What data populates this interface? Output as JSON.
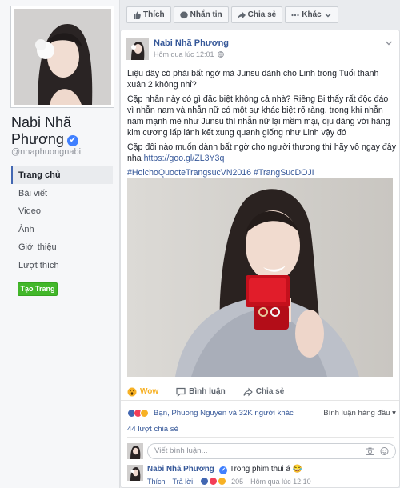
{
  "profile": {
    "name": "Nabi Nhã Phương",
    "handle": "@nhaphuongnabi",
    "verified_mark": "✔"
  },
  "nav": {
    "items": [
      {
        "label": "Trang chủ",
        "active": true
      },
      {
        "label": "Bài viết",
        "active": false
      },
      {
        "label": "Video",
        "active": false
      },
      {
        "label": "Ảnh",
        "active": false
      },
      {
        "label": "Giới thiệu",
        "active": false
      },
      {
        "label": "Lượt thích",
        "active": false
      }
    ],
    "create_page": "Tạo Trang"
  },
  "top_actions": {
    "like": "Thích",
    "message": "Nhắn tin",
    "share": "Chia sẻ",
    "more": "Khác"
  },
  "post": {
    "author": "Nabi Nhã Phương",
    "time": "Hôm qua lúc 12:01",
    "p1": "Liệu đây có phải bất ngờ mà Junsu dành cho Linh trong Tuổi thanh xuân 2 không nhỉ?",
    "p2": "Cặp nhẫn này có gì đặc biệt không cả nhà? Riêng Bi thấy rất độc đáo vì nhẫn nam và nhẫn nữ có một sự khác biệt rõ ràng, trong khi nhẫn nam mạnh mẽ như Junsu thì nhẫn nữ lại mềm mại, dịu dàng với hàng kim cương lấp lánh kết xung quanh giống như Linh vậy đó",
    "p3_text": "Cặp đôi nào muốn dành bất ngờ cho người thương thì hãy vô ngay đây nha ",
    "p3_link": "https://goo.gl/ZL3Y3q",
    "hashtags": "#HoichoQuocteTrangsucVN2016 #TrangSucDOJI"
  },
  "reactions": {
    "wow": "Wow",
    "comment": "Bình luận",
    "share": "Chia sẻ",
    "summary": "Bạn, Phuong Nguyen và 32K người khác",
    "sort": "Bình luận hàng đầu",
    "shares": "44 lượt chia sẻ"
  },
  "compose": {
    "placeholder": "Viết bình luận..."
  },
  "comment": {
    "author": "Nabi Nhã Phương",
    "text": "Trong phim thui á",
    "emoji": "😂",
    "like": "Thích",
    "reply": "Trả lời",
    "count": "205",
    "time": "Hôm qua lúc 12:10"
  },
  "colors": {
    "link": "#365899",
    "accent": "#4267b2",
    "green": "#42b72a",
    "wow": "#f7b125"
  }
}
